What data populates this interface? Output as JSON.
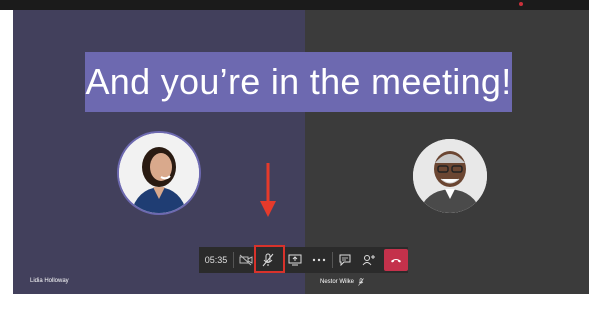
{
  "caption": {
    "text": "And you’re in the meeting!"
  },
  "participants": {
    "left_name": "Lidia Holloway",
    "right_name": "Nestor Wilke"
  },
  "callbar": {
    "timer": "05:35",
    "buttons": [
      {
        "name": "camera-off-icon"
      },
      {
        "name": "mic-muted-icon"
      },
      {
        "name": "share-screen-icon"
      },
      {
        "name": "more-options-icon"
      },
      {
        "name": "chat-icon"
      },
      {
        "name": "add-participant-icon"
      },
      {
        "name": "hang-up-icon"
      }
    ]
  },
  "colors": {
    "caption_bg": "#6d69b0",
    "left_tile": "#42405c",
    "right_tile": "#3b3b3b",
    "callbar": "#2b2b2b",
    "hangup": "#c4314b",
    "highlight": "#d8322b"
  }
}
